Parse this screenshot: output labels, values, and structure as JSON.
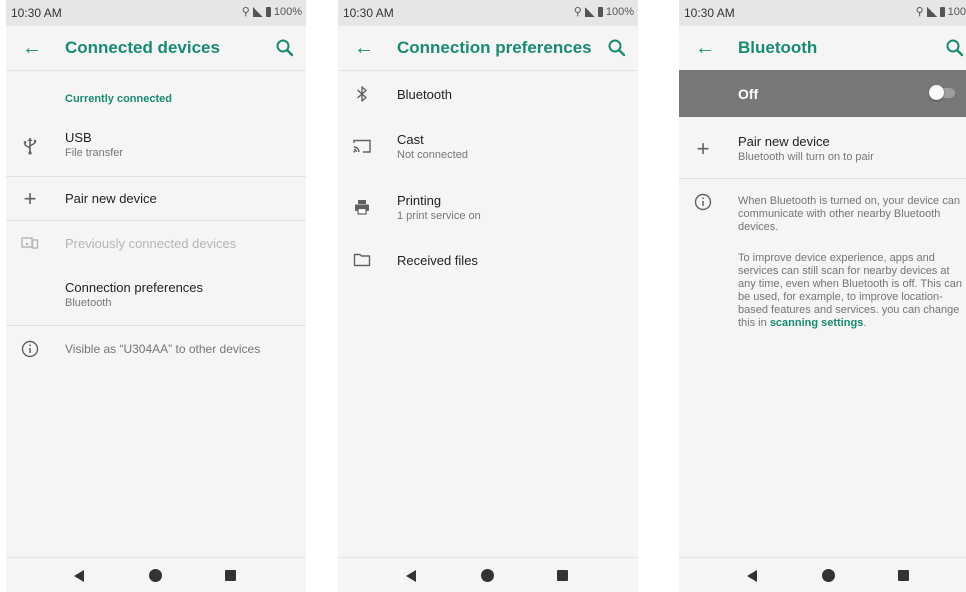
{
  "status": {
    "time": "10:30 AM",
    "battery_full": "100%",
    "battery_cut": "100"
  },
  "p1": {
    "title": "Connected devices",
    "section": "Currently connected",
    "usb_title": "USB",
    "usb_sub": "File transfer",
    "pair": "Pair new device",
    "previous": "Previously connected devices",
    "pref_title": "Connection preferences",
    "pref_sub": "Bluetooth",
    "visible": "Visible as “U304AA” to other devices"
  },
  "p2": {
    "title": "Connection preferences",
    "bt": "Bluetooth",
    "cast_title": "Cast",
    "cast_sub": "Not connected",
    "print_title": "Printing",
    "print_sub": "1 print service on",
    "files": "Received files"
  },
  "p3": {
    "title": "Bluetooth",
    "toggle_label": "Off",
    "pair_title": "Pair new device",
    "pair_sub": "Bluetooth will turn on to pair",
    "info1": "When Bluetooth is turned on, your device can communicate with other nearby Bluetooth devices.",
    "info2": "To improve device experience, apps and services can still scan for nearby devices at any time, even when Bluetooth is off. This can be used, for example, to improve location-based features and services. you can change this in",
    "info2_link": "scanning settings",
    "info2_end": "."
  },
  "colors": {
    "accent": "#1a8a73",
    "toggle_bar": "#787878",
    "background": "#f5f5f5"
  },
  "icons": [
    "back-arrow-icon",
    "search-icon",
    "usb-icon",
    "plus-icon",
    "devices-icon",
    "info-icon",
    "bluetooth-icon",
    "cast-icon",
    "printer-icon",
    "folder-icon",
    "nav-back-icon",
    "nav-home-icon",
    "nav-recents-icon"
  ]
}
